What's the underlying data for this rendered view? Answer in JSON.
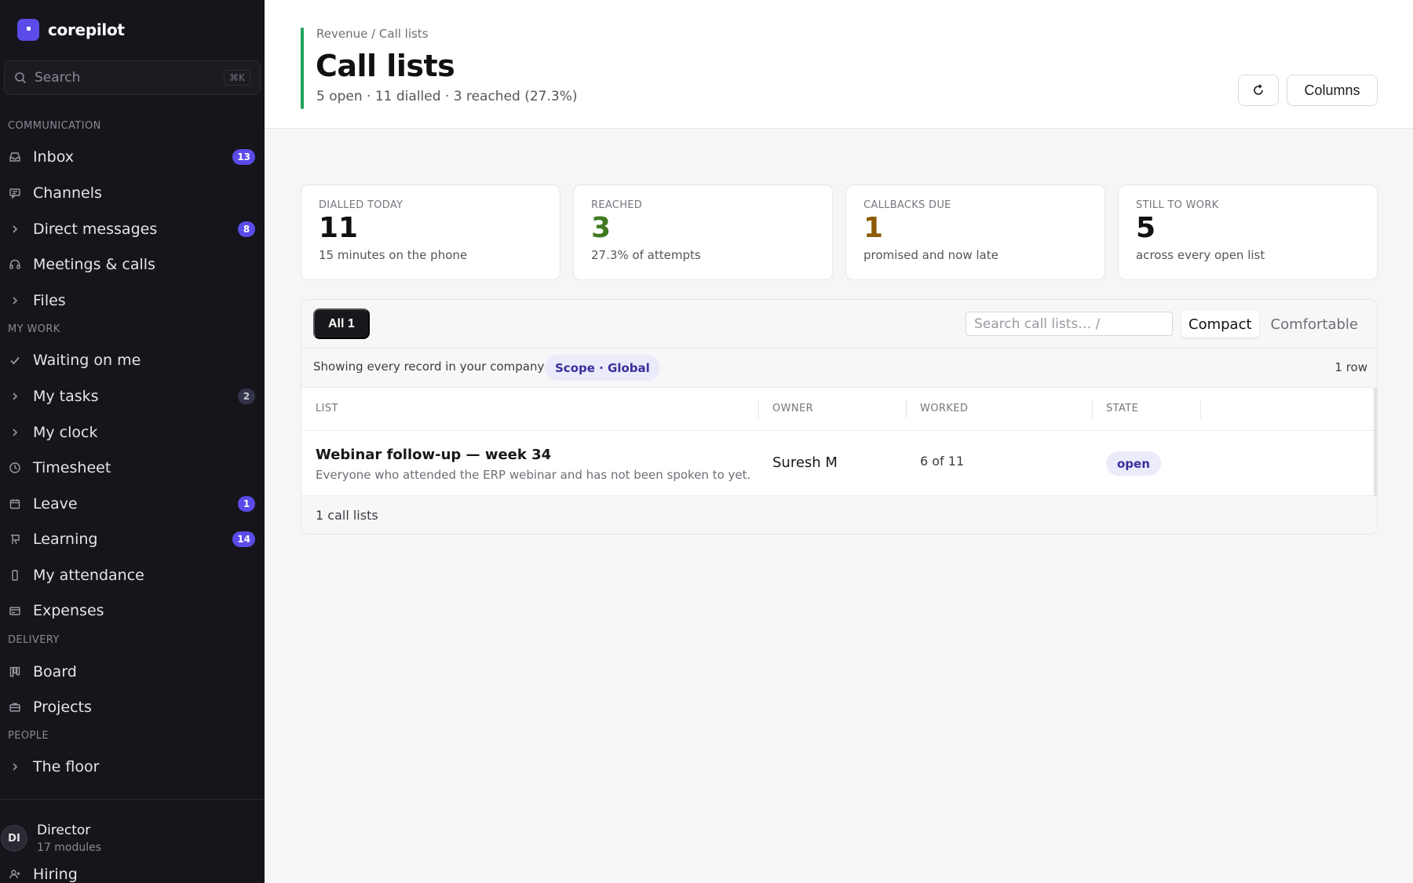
{
  "app": {
    "name": "corepilot"
  },
  "search": {
    "placeholder": "Search",
    "shortcut": "⌘K"
  },
  "sections": {
    "communication": "COMMUNICATION",
    "my_work": "MY WORK",
    "delivery": "DELIVERY",
    "people": "PEOPLE"
  },
  "nav": {
    "inbox": {
      "label": "Inbox",
      "icon": "inbox-icon",
      "badge": "13"
    },
    "channels": {
      "label": "Channels",
      "icon": "chat-icon"
    },
    "direct_messages": {
      "label": "Direct messages",
      "icon": "chevron-right-icon",
      "badge": "8"
    },
    "meetings": {
      "label": "Meetings & calls",
      "icon": "headset-icon"
    },
    "files": {
      "label": "Files",
      "icon": "chevron-right-icon"
    },
    "waiting": {
      "label": "Waiting on me",
      "icon": "check-icon"
    },
    "my_tasks": {
      "label": "My tasks",
      "icon": "chevron-right-icon",
      "badge": "2"
    },
    "my_clock": {
      "label": "My clock",
      "icon": "chevron-right-icon"
    },
    "timesheet": {
      "label": "Timesheet",
      "icon": "clock-icon"
    },
    "leave": {
      "label": "Leave",
      "icon": "calendar-icon",
      "badge": "1"
    },
    "learning": {
      "label": "Learning",
      "icon": "board-icon",
      "badge": "14"
    },
    "my_attendance": {
      "label": "My attendance",
      "icon": "phone-icon"
    },
    "expenses": {
      "label": "Expenses",
      "icon": "card-icon"
    },
    "board": {
      "label": "Board",
      "icon": "kanban-icon"
    },
    "projects": {
      "label": "Projects",
      "icon": "briefcase-icon"
    },
    "the_floor": {
      "label": "The floor",
      "icon": "chevron-right-icon"
    },
    "hiring": {
      "label": "Hiring",
      "icon": "user-plus-icon"
    }
  },
  "user": {
    "initials": "DI",
    "name": "Director",
    "sub": "17 modules"
  },
  "header": {
    "breadcrumb": "Revenue / Call lists",
    "title": "Call lists",
    "subtitle": "5 open · 11 dialled · 3 reached (27.3%)",
    "columns_label": "Columns",
    "accent_color": "#1fa25a"
  },
  "stats": [
    {
      "label": "DIALLED TODAY",
      "value": "11",
      "note": "15 minutes on the phone",
      "color": "#111114"
    },
    {
      "label": "REACHED",
      "value": "3",
      "note": "27.3% of attempts",
      "color": "#3f7a21"
    },
    {
      "label": "CALLBACKS DUE",
      "value": "1",
      "note": "promised and now late",
      "color": "#8d5c08"
    },
    {
      "label": "STILL TO WORK",
      "value": "5",
      "note": "across every open list",
      "color": "#111114"
    }
  ],
  "table": {
    "filter_all": "All 1",
    "search_placeholder": "Search call lists…  /",
    "density": {
      "compact": "Compact",
      "comfortable": "Comfortable",
      "selected": "Compact"
    },
    "scope_text": "Showing every record in your company",
    "scope_chip": "Scope · Global",
    "row_count": "1 row",
    "columns": [
      "LIST",
      "OWNER",
      "WORKED",
      "STATE"
    ],
    "rows": [
      {
        "title": "Webinar follow-up — week 34",
        "description": "Everyone who attended the ERP webinar and has not been spoken to yet.",
        "owner": "Suresh M",
        "worked": "6 of 11",
        "state": "open"
      }
    ],
    "footer": "1 call lists"
  }
}
